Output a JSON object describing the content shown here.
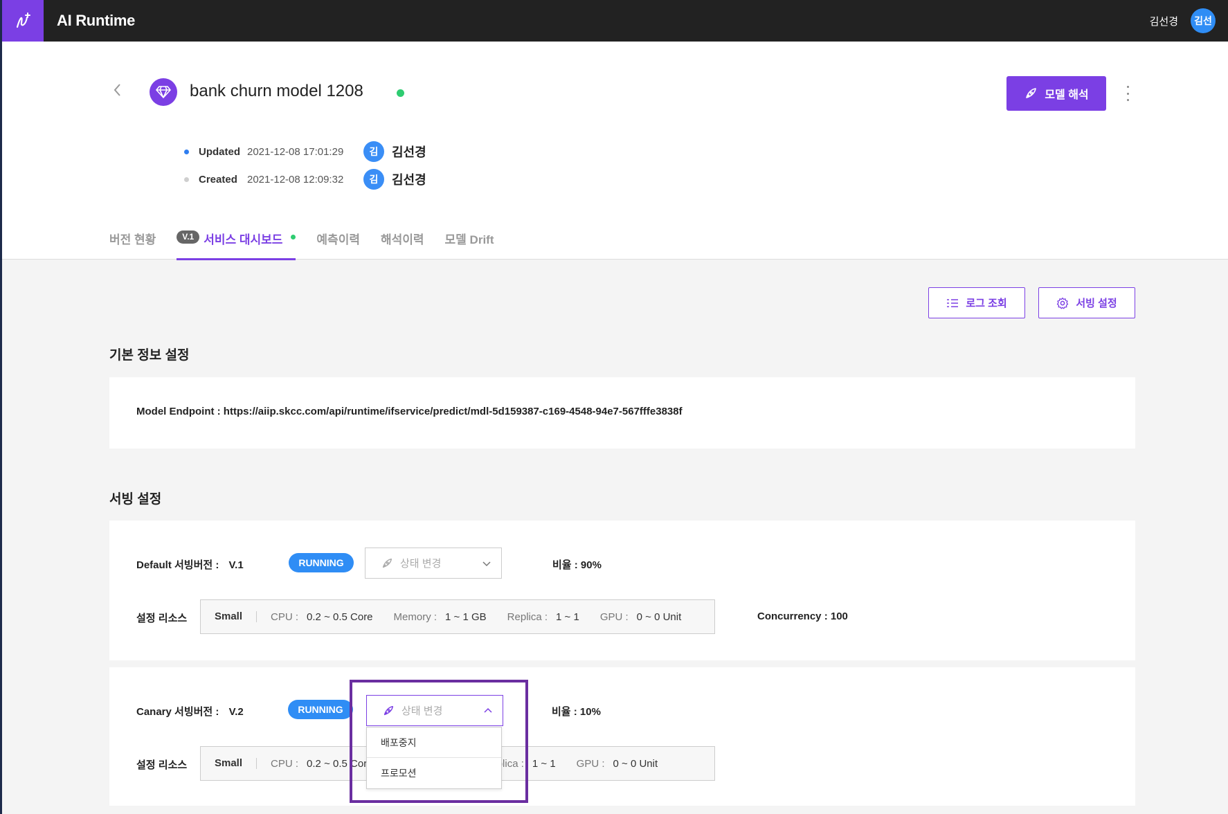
{
  "topbar": {
    "app_title": "AI Runtime",
    "user_name": "김선경",
    "user_avatar": "김선"
  },
  "model": {
    "title": "bank churn model 1208",
    "explain_button": "모델 해석",
    "updated_label": "Updated",
    "updated_time": "2021-12-08 17:01:29",
    "updated_avatar": "김",
    "updated_user": "김선경",
    "created_label": "Created",
    "created_time": "2021-12-08 12:09:32",
    "created_avatar": "김",
    "created_user": "김선경"
  },
  "tabs": [
    {
      "label": "버전 현황"
    },
    {
      "badge": "V.1",
      "label": "서비스 대시보드",
      "active": true
    },
    {
      "label": "예측이력"
    },
    {
      "label": "해석이력"
    },
    {
      "label": "모델 Drift"
    }
  ],
  "actions": {
    "log_button": "로그 조회",
    "serving_button": "서빙 설정"
  },
  "basic_info": {
    "title": "기본 정보 설정",
    "endpoint": "Model Endpoint : https://aiip.skcc.com/api/runtime/ifservice/predict/mdl-5d159387-c169-4548-94e7-567fffe3838f"
  },
  "serving": {
    "title": "서빙 설정",
    "default": {
      "label": "Default 서빙버전 :",
      "version": "V.1",
      "status": "RUNNING",
      "select_placeholder": "상태 변경",
      "ratio": "비율 : 90%",
      "resource_label": "설정 리소스",
      "size": "Small",
      "cpu_label": "CPU :",
      "cpu": "0.2 ~ 0.5 Core",
      "memory_label": "Memory :",
      "memory": "1 ~ 1 GB",
      "replica_label": "Replica :",
      "replica": "1 ~ 1",
      "gpu_label": "GPU :",
      "gpu": "0 ~ 0 Unit",
      "concurrency": "Concurrency : 100"
    },
    "canary": {
      "label": "Canary 서빙버전 :",
      "version": "V.2",
      "status": "RUNNING",
      "select_placeholder": "상태 변경",
      "ratio": "비율 : 10%",
      "resource_label": "설정 리소스",
      "size": "Small",
      "cpu_label": "CPU :",
      "cpu": "0.2 ~ 0.5 Core",
      "replica_label": "Replica :",
      "replica": "1 ~ 1",
      "gpu_label": "GPU :",
      "gpu": "0 ~ 0 Unit",
      "dropdown_options": [
        "배포중지",
        "프로모션"
      ]
    }
  },
  "colors": {
    "accent": "#7b3fe4",
    "running": "#2f8df5",
    "online": "#2ecc71",
    "topbar": "#222222",
    "highlight": "#6a2ea0"
  }
}
